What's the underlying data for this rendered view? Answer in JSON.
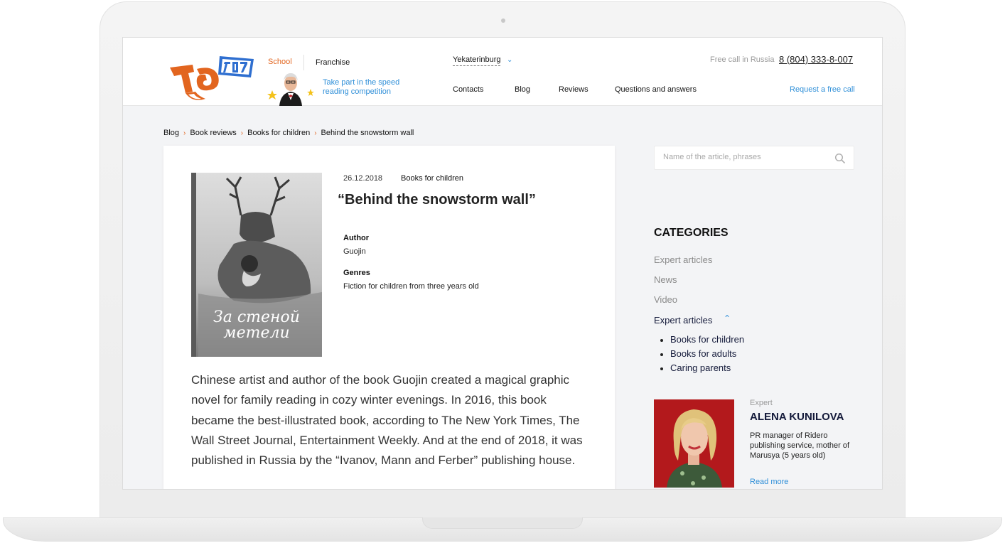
{
  "header": {
    "nav_school": "School",
    "nav_franchise": "Franchise",
    "promo_text": "Take part in the speed reading competition",
    "city": "Yekaterinburg",
    "free_call_label": "Free call in Russia",
    "phone": "8 (804) 333-8-007",
    "request_call": "Request a free call",
    "nav": [
      "Contacts",
      "Blog",
      "Reviews",
      "Questions and answers"
    ]
  },
  "breadcrumb": [
    "Blog",
    "Book reviews",
    "Books for children",
    "Behind the snowstorm wall"
  ],
  "article": {
    "date": "26.12.2018",
    "category": "Books for children",
    "title": "“Behind the snowstorm wall”",
    "author_label": "Author",
    "author": "Guojin",
    "genres_label": "Genres",
    "genres": "Fiction for children from three years old",
    "body": "Chinese artist and author of the book Guojin created a magical graphic novel for family reading in cozy winter evenings. In 2016, this book became the best-illustrated book, according to The New York Times, The Wall Street Journal, Entertainment Weekly. And at the end of 2018, it was published in Russia by the “Ivanov, Mann and Ferber” publishing house."
  },
  "sidebar": {
    "search_placeholder": "Name of the article, phrases",
    "categories_title": "CATEGORIES",
    "categories": [
      "Expert articles",
      "News",
      "Video"
    ],
    "active_category": "Expert articles",
    "subcategories": [
      "Books for children",
      "Books for adults",
      "Caring parents"
    ],
    "expert": {
      "label": "Expert",
      "name": "ALENA KUNILOVA",
      "description": "PR manager of Ridero publishing service, mother of Marusya (5 years old)",
      "read_more": "Read more"
    }
  },
  "colors": {
    "accent_orange": "#e2651f",
    "accent_blue": "#2f8fd8",
    "dark_navy": "#141a3a"
  }
}
